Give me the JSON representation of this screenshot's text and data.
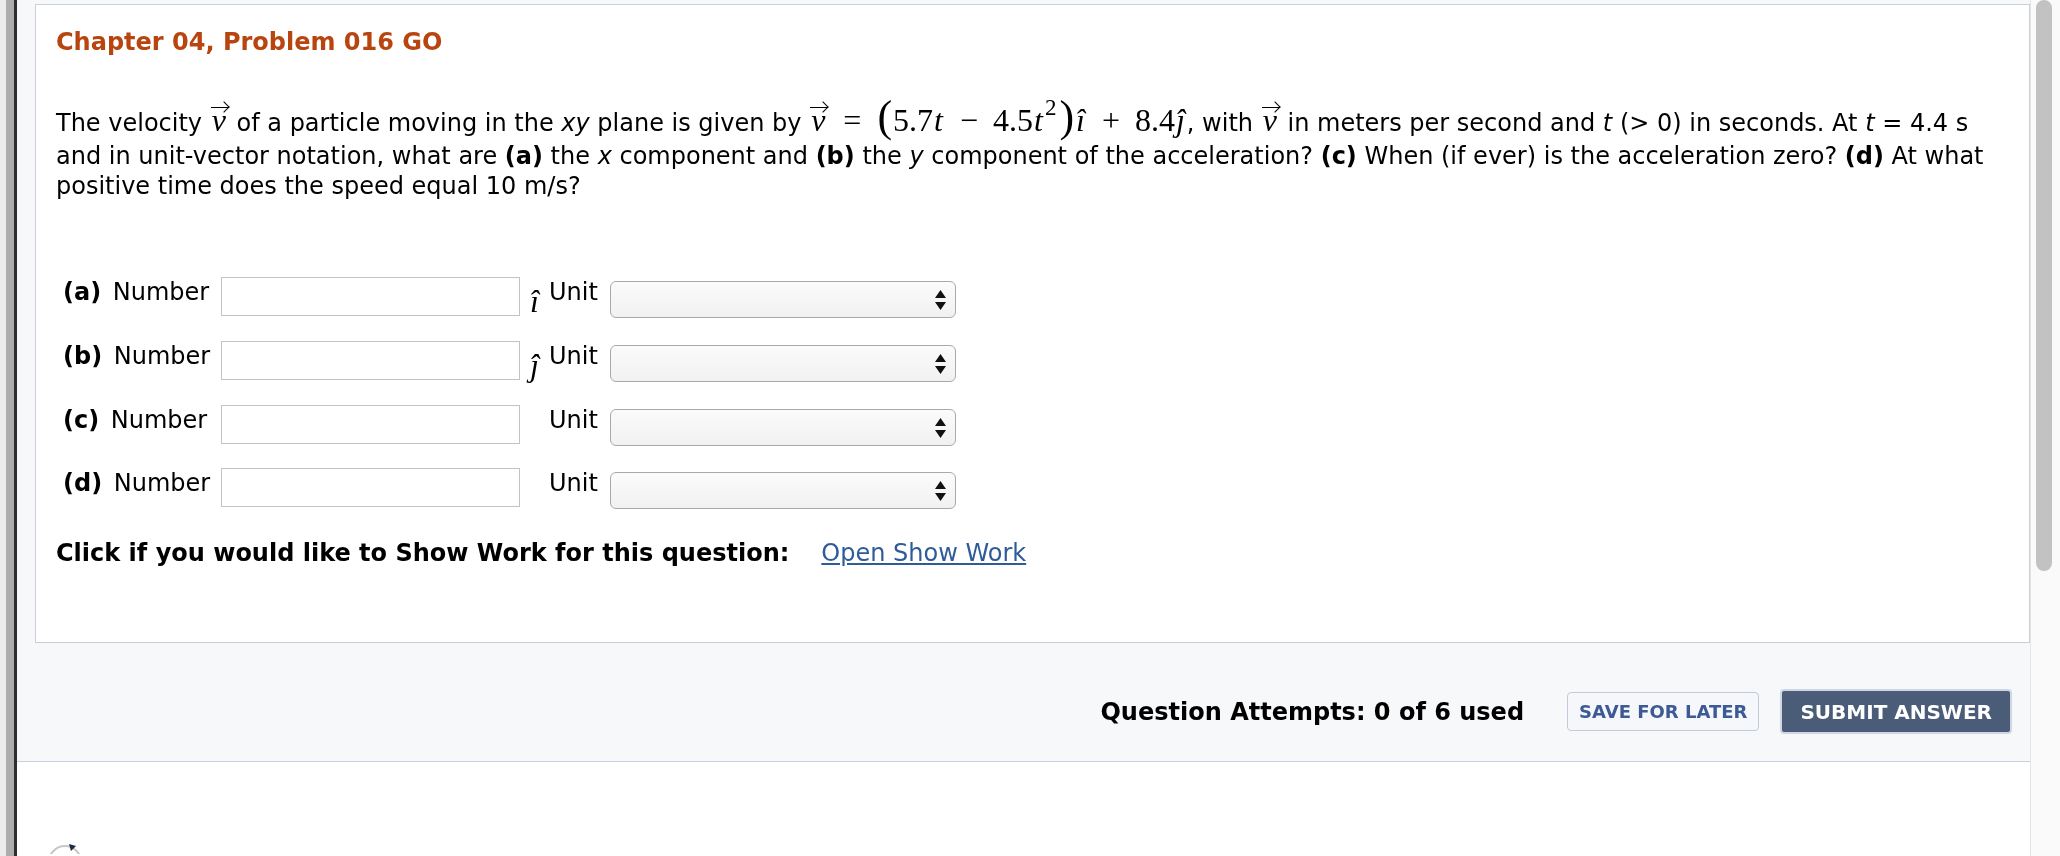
{
  "problem": {
    "title": "Chapter 04, Problem 016 GO",
    "segments": [
      {
        "kind": "text",
        "text": "The velocity "
      },
      {
        "kind": "vector",
        "text": "v"
      },
      {
        "kind": "text",
        "text": " of a particle moving in the *xy* plane is given by "
      },
      {
        "kind": "vector",
        "text": "v"
      },
      {
        "kind": "math",
        "text": " = "
      },
      {
        "kind": "paren",
        "text": "("
      },
      {
        "kind": "math",
        "text": "5.7"
      },
      {
        "kind": "variable",
        "text": "t"
      },
      {
        "kind": "math",
        "text": " − 4.5"
      },
      {
        "kind": "variable",
        "text": "t"
      },
      {
        "kind": "superscript",
        "text": "2"
      },
      {
        "kind": "paren",
        "text": ")"
      },
      {
        "kind": "variable",
        "text": "î"
      },
      {
        "kind": "math",
        "text": " + 8.4"
      },
      {
        "kind": "variable",
        "text": "ĵ"
      },
      {
        "kind": "text",
        "text": ", with "
      },
      {
        "kind": "vector",
        "text": "v"
      },
      {
        "kind": "text",
        "text": " in meters per second and *t* (> 0) in seconds. At *t* = 4.4 s and in unit-vector notation, what are **(a)** the *x* component and **(b)** the *y* component of the acceleration? **(c)** When (if ever) is the acceleration zero? **(d)** At what positive time does the speed equal 10 m/s?"
      }
    ]
  },
  "answers": [
    {
      "label": "**(a)** Number",
      "unit_vector": "î",
      "unit_label": "Unit"
    },
    {
      "label": "**(b)** Number",
      "unit_vector": "ĵ",
      "unit_label": "Unit"
    },
    {
      "label": "**(c)** Number",
      "unit_label": "Unit"
    },
    {
      "label": "**(d)** Number",
      "unit_label": "Unit"
    }
  ],
  "show_work": {
    "prompt": "Click if you would like to Show Work for this question:",
    "link": "Open Show Work"
  },
  "footer": {
    "attempts": "Question Attempts: 0 of 6 used",
    "buttons": [
      {
        "label": "SAVE FOR LATER",
        "kind": "secondary"
      },
      {
        "label": "SUBMIT ANSWER",
        "kind": "primary"
      }
    ]
  }
}
